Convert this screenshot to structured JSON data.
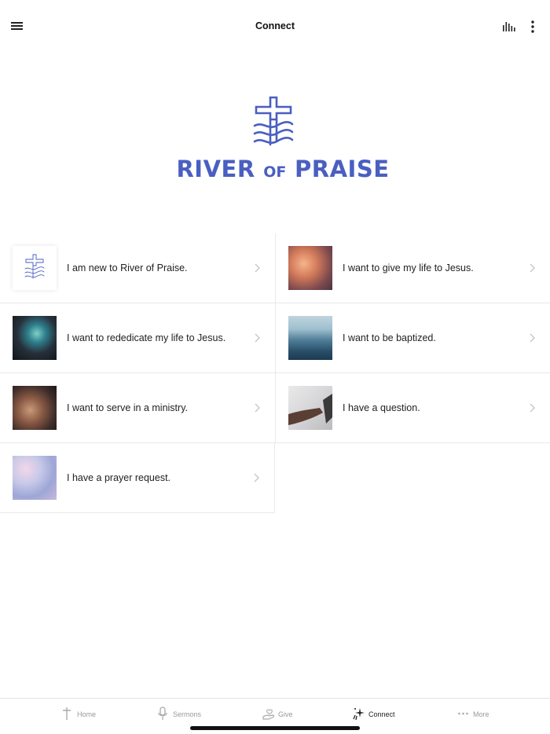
{
  "header": {
    "title": "Connect"
  },
  "logo": {
    "name_part1": "RIVER ",
    "name_part2": "OF",
    "name_part3": " PRAISE",
    "brand_color": "#4a5fc1"
  },
  "connect_items": [
    {
      "label": "I am new to River of Praise.",
      "thumbnail": "river-of-praise-logo"
    },
    {
      "label": "I want to give my life to Jesus.",
      "thumbnail": "sunset-clouds-photo"
    },
    {
      "label": "I want to rededicate my life to Jesus.",
      "thumbnail": "worship-concert-photo"
    },
    {
      "label": "I want to be baptized.",
      "thumbnail": "ocean-waves-photo"
    },
    {
      "label": "I want to serve in a ministry.",
      "thumbnail": "hands-photo"
    },
    {
      "label": "I have a question.",
      "thumbnail": "hand-guitar-photo"
    },
    {
      "label": "I have a prayer request.",
      "thumbnail": "pastel-sky-photo"
    }
  ],
  "tabbar": {
    "tabs": [
      {
        "label": "Home",
        "icon": "cross-icon"
      },
      {
        "label": "Sermons",
        "icon": "microphone-icon"
      },
      {
        "label": "Give",
        "icon": "giving-hand-icon"
      },
      {
        "label": "Connect",
        "icon": "sparkle-icon",
        "active": true
      },
      {
        "label": "More",
        "icon": "more-dots-icon"
      }
    ]
  }
}
